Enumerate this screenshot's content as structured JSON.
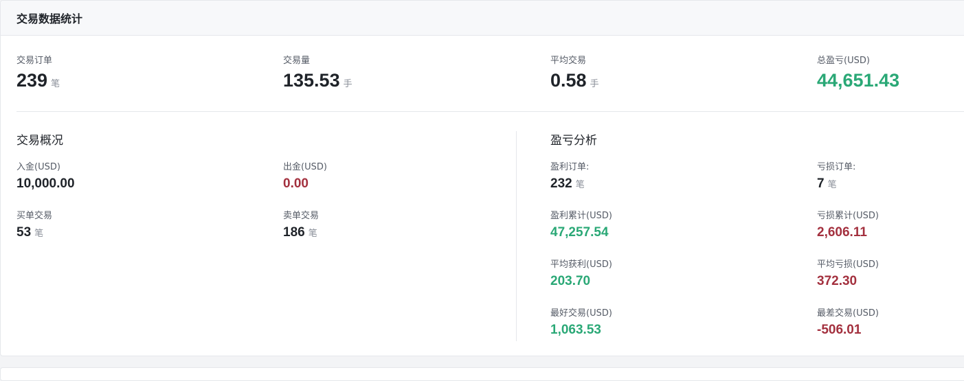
{
  "header": {
    "title": "交易数据统计"
  },
  "summary": [
    {
      "label": "交易订单",
      "value": "239",
      "unit": "笔",
      "color": "default"
    },
    {
      "label": "交易量",
      "value": "135.53",
      "unit": "手",
      "color": "default"
    },
    {
      "label": "平均交易",
      "value": "0.58",
      "unit": "手",
      "color": "default"
    },
    {
      "label": "总盈亏(USD)",
      "value": "44,651.43",
      "unit": "",
      "color": "green"
    }
  ],
  "overview": {
    "title": "交易概况",
    "deposit": {
      "label": "入金(USD)",
      "value": "10,000.00"
    },
    "withdraw": {
      "label": "出金(USD)",
      "value": "0.00"
    },
    "buy": {
      "label": "买单交易",
      "value": "53",
      "unit": "笔"
    },
    "sell": {
      "label": "卖单交易",
      "value": "186",
      "unit": "笔"
    }
  },
  "pnl": {
    "title": "盈亏分析",
    "win_orders": {
      "label": "盈利订单:",
      "value": "232",
      "unit": "笔"
    },
    "loss_orders": {
      "label": "亏损订单:",
      "value": "7",
      "unit": "笔"
    },
    "win_total": {
      "label": "盈利累计(USD)",
      "value": "47,257.54"
    },
    "loss_total": {
      "label": "亏损累计(USD)",
      "value": "2,606.11"
    },
    "avg_win": {
      "label": "平均获利(USD)",
      "value": "203.70"
    },
    "avg_loss": {
      "label": "平均亏损(USD)",
      "value": "372.30"
    },
    "best": {
      "label": "最好交易(USD)",
      "value": "1,063.53"
    },
    "worst": {
      "label": "最差交易(USD)",
      "value": "-506.01"
    }
  },
  "colors": {
    "profit": "#2aa876",
    "loss": "#a3303e",
    "text": "#1f2329",
    "muted": "#8a8f99"
  }
}
